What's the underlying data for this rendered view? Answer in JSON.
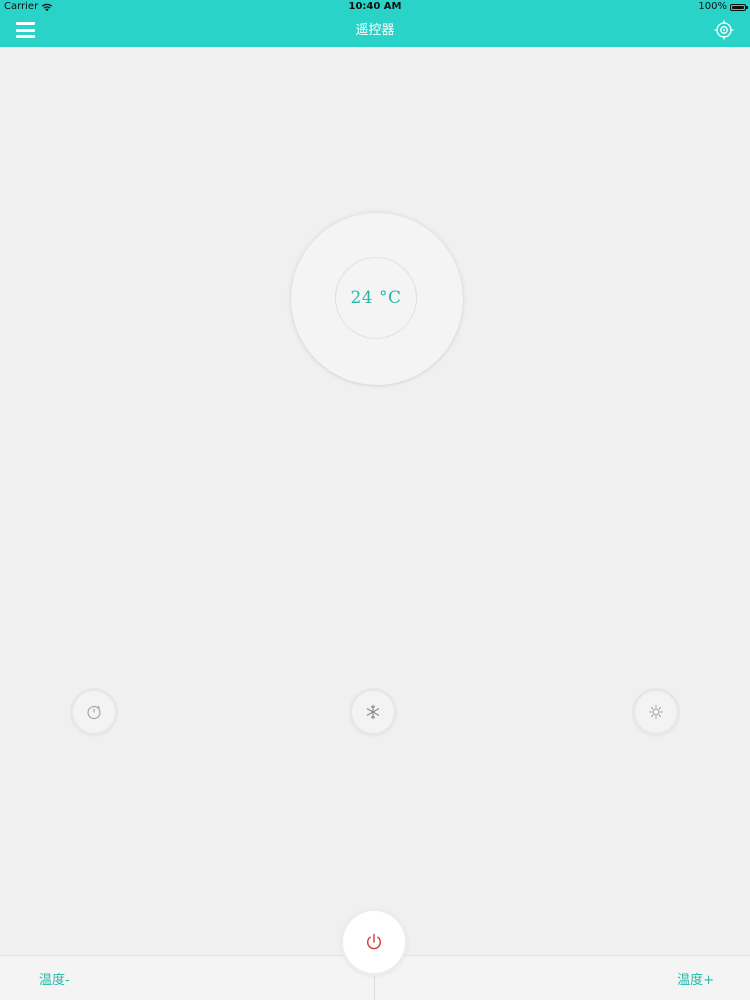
{
  "status_bar": {
    "carrier": "Carrier",
    "time": "10:40 AM",
    "battery": "100%"
  },
  "nav": {
    "title": "遥控器",
    "menu_icon": "hamburger-menu-icon",
    "right_icon": "crosshair-target-icon"
  },
  "thermostat": {
    "temperature": "24 °C"
  },
  "modes": [
    {
      "icon": "timer-icon"
    },
    {
      "icon": "snowflake-icon"
    },
    {
      "icon": "sun-icon"
    }
  ],
  "bottom": {
    "temp_down_label": "温度-",
    "temp_up_label": "温度+",
    "power_icon": "power-icon"
  },
  "colors": {
    "accent": "#29d3c8",
    "text_accent": "#22b9a8",
    "background": "#f1f0f1",
    "power": "#d23a3a"
  }
}
